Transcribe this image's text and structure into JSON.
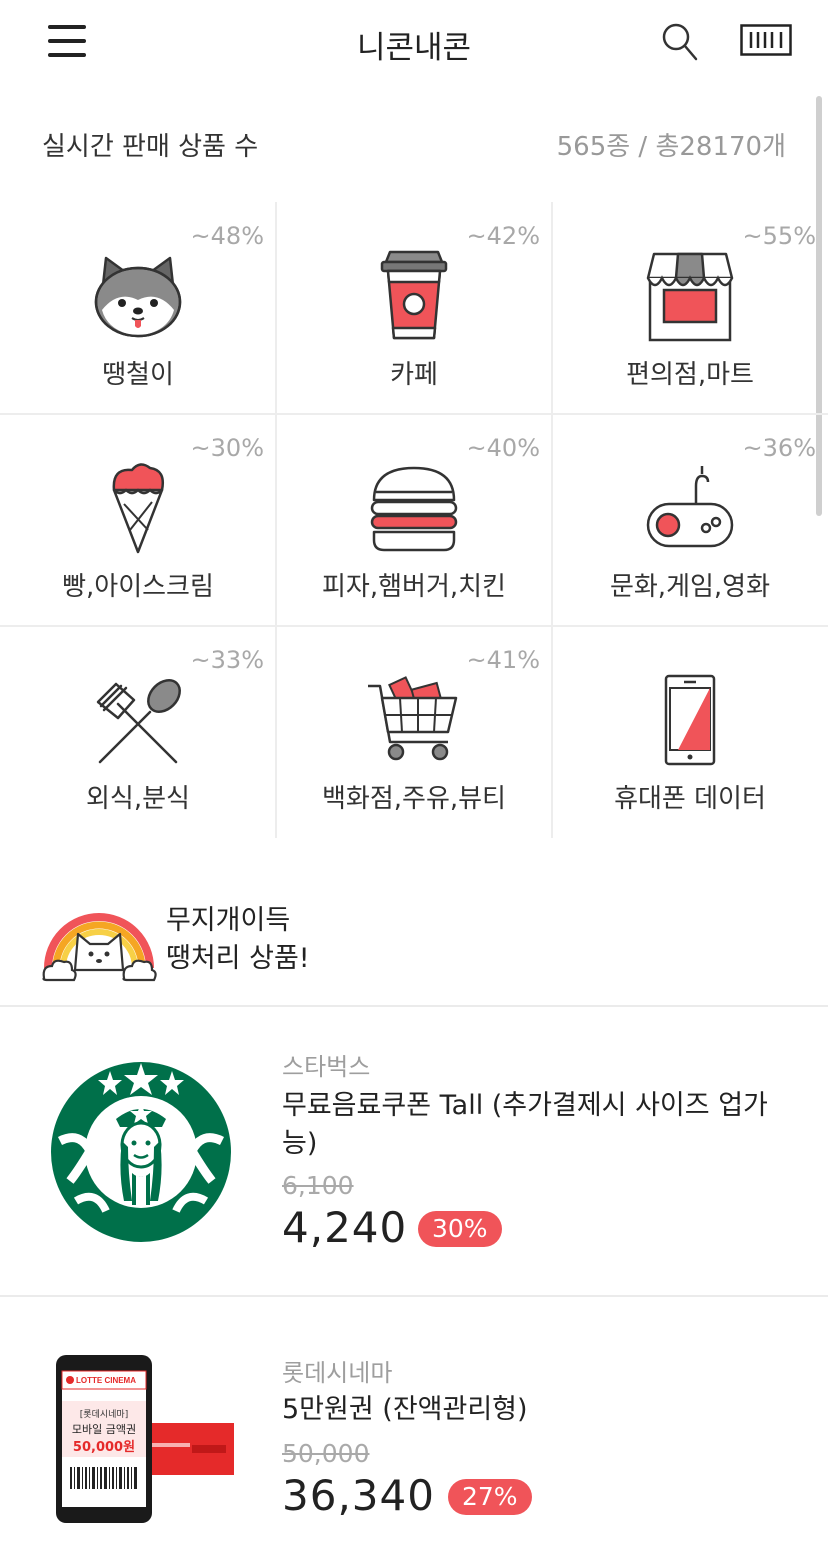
{
  "header": {
    "title": "니콘내콘"
  },
  "stats": {
    "label": "실시간 판매 상품 수",
    "value": "565종 / 총28170개"
  },
  "categories": [
    {
      "label": "땡철이",
      "pct": "~48%",
      "icon": "shiba-dog-icon"
    },
    {
      "label": "카페",
      "pct": "~42%",
      "icon": "coffee-cup-icon"
    },
    {
      "label": "편의점,마트",
      "pct": "~55%",
      "icon": "store-icon"
    },
    {
      "label": "빵,아이스크림",
      "pct": "~30%",
      "icon": "ice-cream-icon"
    },
    {
      "label": "피자,햄버거,치킨",
      "pct": "~40%",
      "icon": "burger-icon"
    },
    {
      "label": "문화,게임,영화",
      "pct": "~36%",
      "icon": "game-controller-icon"
    },
    {
      "label": "외식,분식",
      "pct": "~33%",
      "icon": "fork-spoon-icon"
    },
    {
      "label": "백화점,주유,뷰티",
      "pct": "~41%",
      "icon": "shopping-cart-icon"
    },
    {
      "label": "휴대폰 데이터",
      "pct": "",
      "icon": "smartphone-icon"
    }
  ],
  "deal": {
    "line1": "무지개이득",
    "line2": "땡처리 상품!"
  },
  "products": [
    {
      "brand": "스타벅스",
      "name": "무료음료쿠폰 Tall (추가결제시 사이즈 업가능)",
      "original_price": "6,100",
      "price": "4,240",
      "discount": "30%"
    },
    {
      "brand": "롯데시네마",
      "name": "5만원권 (잔액관리형)",
      "original_price": "50,000",
      "price": "36,340",
      "discount": "27%",
      "thumb_text": {
        "logo": "LOTTE CINEMA",
        "line1": "[롯데시네마]",
        "line2": "모바일 금액권",
        "amount": "50,000원"
      }
    }
  ],
  "colors": {
    "accent": "#f05459",
    "icon_stroke": "#333333",
    "muted": "#999999",
    "starbucks_green": "#00704a"
  }
}
